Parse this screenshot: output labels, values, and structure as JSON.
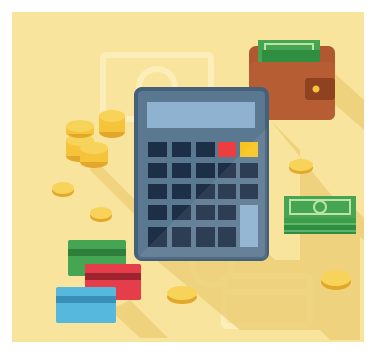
{
  "illustration": {
    "subject": "finance",
    "objects": [
      "calculator-icon",
      "wallet-icon",
      "cash-stack-icon",
      "coin-stack-icon",
      "credit-card-icon",
      "coin-icon",
      "banknote-outline-icon",
      "card-outline-icon"
    ]
  },
  "colors": {
    "frame": "#ffffff",
    "background": "#f8e49c",
    "outline": "#fbeeb8",
    "shadow": "#eed078",
    "calculator_body": "#5b7891",
    "calculator_border": "#44607a",
    "calculator_screen": "#8fb2d0",
    "calculator_key": "#1c2f47",
    "calculator_key_red": "#ec3e41",
    "calculator_key_yellow": "#f8c520",
    "wallet": "#b0582f",
    "cash_green": "#45a553",
    "coin_gold": "#f5c43a",
    "card_green": "#45a553",
    "card_red": "#e53e4a",
    "card_blue": "#57b8dd"
  }
}
